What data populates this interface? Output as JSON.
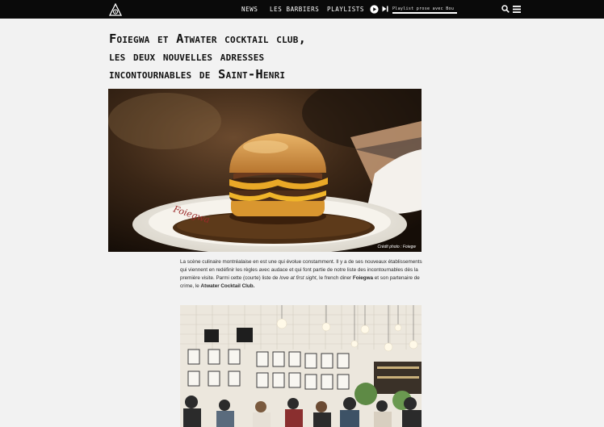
{
  "nav": {
    "links": [
      "News",
      "Les barbiers",
      "Playlists"
    ],
    "playlist_text": "Playlist prose avec Bou",
    "logo_label": "Logo"
  },
  "article": {
    "title_line1": "Foiegwa et Atwater cocktail club,",
    "title_line2": "les deux nouvelles adresses",
    "title_line3": "incontournables de Saint-Henri",
    "hero_credit": "Crédit photo : Foiegw",
    "intro": {
      "part1": "La scène culinaire montréalaise en est une qui évolue constamment. Il y a de ses nouveaux établissements qui viennent en redéfinir les règles avec audace et qui font partie de notre liste des incontournables dès la première visite. Parmi cette (courte) liste de ",
      "em": "love at first sight",
      "part2": ", le french diner ",
      "strong1": "Foiegwa",
      "part3": " et son partenaire de crime, le ",
      "strong2": "Atwater Cocktail Club."
    }
  },
  "colors": {
    "nav_bg": "#0a0a0a",
    "page_bg": "#f2f2f2",
    "text": "#222222"
  },
  "icons": [
    "barbershop-logo-icon",
    "play-icon",
    "next-track-icon",
    "search-icon",
    "menu-icon"
  ]
}
